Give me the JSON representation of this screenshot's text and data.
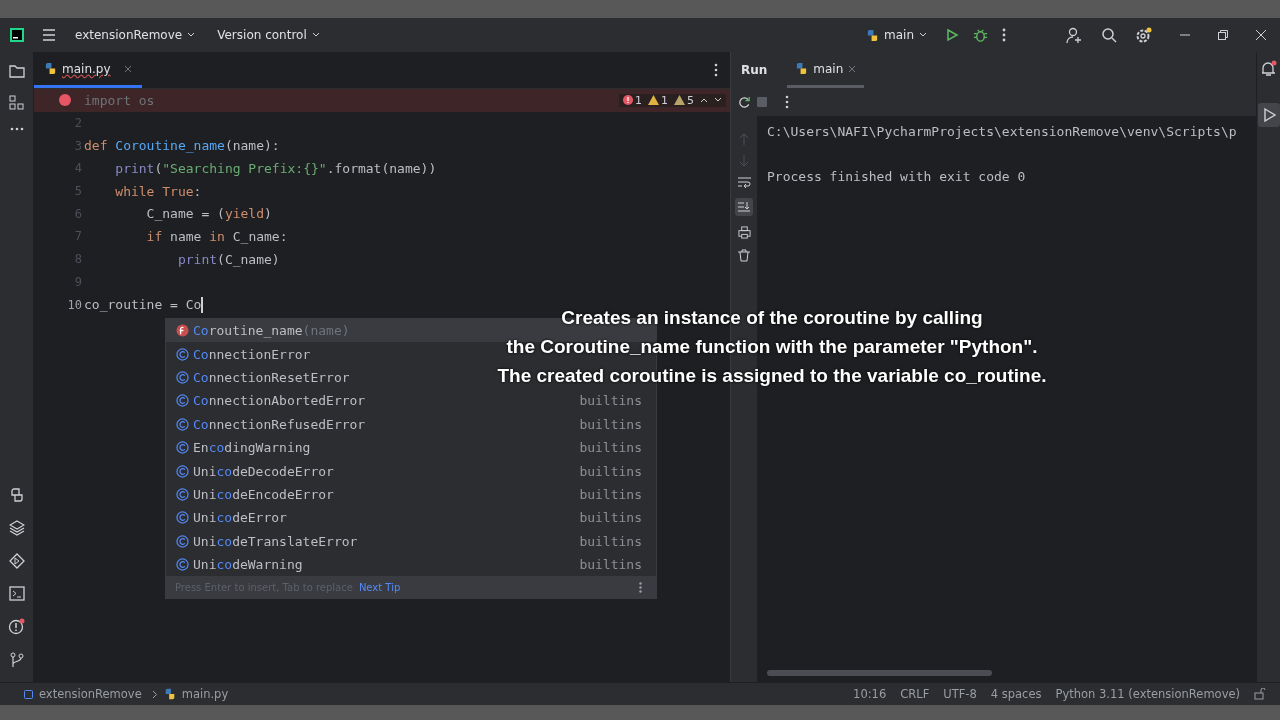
{
  "title_bar": {
    "project": "extensionRemove",
    "vcs": "Version control",
    "run_config": "main"
  },
  "editor": {
    "tabs": [
      {
        "label": "main.py",
        "selected": true
      }
    ],
    "problems": [
      {
        "kind": "error",
        "count": "1"
      },
      {
        "kind": "warning",
        "count": "1"
      },
      {
        "kind": "weak",
        "count": "5"
      }
    ],
    "lines": [
      {
        "breakpoint": true,
        "current": false,
        "tokens": [
          {
            "t": "import os",
            "kind": "unused"
          }
        ]
      },
      {
        "number": "2",
        "breakpoint": false,
        "current": false
      },
      {
        "number": "3",
        "breakpoint": false,
        "current": false,
        "tokens": [
          {
            "t": "def ",
            "kind": "kw"
          },
          {
            "t": "Coroutine_name",
            "kind": "func"
          },
          {
            "t": "(name):",
            "kind": "plain"
          }
        ]
      },
      {
        "number": "4",
        "breakpoint": false,
        "current": false,
        "tokens": [
          {
            "t": "    print",
            "kind": "builtin"
          },
          {
            "t": "(",
            "kind": "plain"
          },
          {
            "t": "\"Searching Prefix:{}\"",
            "kind": "string"
          },
          {
            "t": ".format(name))",
            "kind": "plain"
          }
        ]
      },
      {
        "number": "5",
        "breakpoint": false,
        "current": false,
        "tokens": [
          {
            "t": "    while True",
            "kind": "kw"
          },
          {
            "t": ":",
            "kind": "plain"
          }
        ]
      },
      {
        "number": "6",
        "breakpoint": false,
        "current": false,
        "tokens": [
          {
            "t": "        C_name = (",
            "kind": "plain"
          },
          {
            "t": "yield",
            "kind": "kw"
          },
          {
            "t": ")",
            "kind": "plain"
          }
        ]
      },
      {
        "number": "7",
        "breakpoint": false,
        "current": false,
        "tokens": [
          {
            "t": "        if",
            "kind": "kw"
          },
          {
            "t": " name ",
            "kind": "plain"
          },
          {
            "t": "in",
            "kind": "kw"
          },
          {
            "t": " C_name:",
            "kind": "plain"
          }
        ]
      },
      {
        "number": "8",
        "breakpoint": false,
        "current": false,
        "tokens": [
          {
            "t": "            print",
            "kind": "builtin"
          },
          {
            "t": "(C_name)",
            "kind": "plain"
          }
        ]
      },
      {
        "number": "9",
        "breakpoint": false,
        "current": false
      },
      {
        "number": "10",
        "breakpoint": false,
        "current": true,
        "tokens": [
          {
            "t": "co_routine = Co",
            "kind": "plain"
          }
        ]
      }
    ],
    "completion": {
      "items": [
        {
          "kind": "function",
          "selected": true,
          "match": "Co",
          "rest": "routine_name",
          "hint": "(name)"
        },
        {
          "kind": "class",
          "selected": false,
          "match": "Co",
          "rest": "nnectionError"
        },
        {
          "kind": "class",
          "selected": false,
          "match": "Co",
          "rest": "nnectionResetError"
        },
        {
          "kind": "class",
          "selected": false,
          "match": "Co",
          "rest": "nnectionAbortedError",
          "hint": "builtins"
        },
        {
          "kind": "class",
          "selected": false,
          "match": "Co",
          "rest": "nnectionRefusedError",
          "hint": "builtins"
        },
        {
          "kind": "class",
          "selected": false,
          "before": "En",
          "match": "co",
          "rest": "dingWarning",
          "hint": "builtins"
        },
        {
          "kind": "class",
          "selected": false,
          "before": "Uni",
          "match": "co",
          "rest": "deDecodeError",
          "hint": "builtins"
        },
        {
          "kind": "class",
          "selected": false,
          "before": "Uni",
          "match": "co",
          "rest": "deEncodeError",
          "hint": "builtins"
        },
        {
          "kind": "class",
          "selected": false,
          "before": "Uni",
          "match": "co",
          "rest": "deError",
          "hint": "builtins"
        },
        {
          "kind": "class",
          "selected": false,
          "before": "Uni",
          "match": "co",
          "rest": "deTranslateError",
          "hint": "builtins"
        },
        {
          "kind": "class",
          "selected": false,
          "before": "Uni",
          "match": "co",
          "rest": "deWarning",
          "hint": "builtins"
        }
      ],
      "footer": "Press Enter to insert, Tab to replace",
      "tip_link": "Next Tip"
    }
  },
  "run_panel": {
    "title": "Run",
    "tabs": [
      {
        "label": "main",
        "selected": true
      }
    ],
    "output": [
      "C:\\Users\\NAFI\\PycharmProjects\\extensionRemove\\venv\\Scripts\\p",
      "Process finished with exit code 0"
    ]
  },
  "caption": [
    "Creates an instance of the coroutine by calling",
    "the Coroutine_name function with the parameter \"Python\".",
    "The created coroutine is assigned to the variable co_routine."
  ],
  "status_bar": {
    "breadcrumbs": [
      "extensionRemove",
      "main.py"
    ],
    "items": [
      "10:16",
      "CRLF",
      "UTF-8",
      "4 spaces",
      "Python 3.11 (extensionRemove)"
    ]
  }
}
